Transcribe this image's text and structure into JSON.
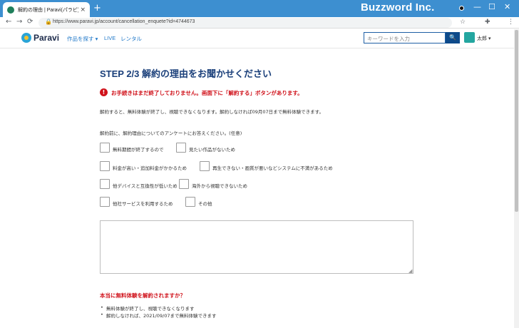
{
  "browser": {
    "tab_title": "解約の理由 | Paravi(パラビ)で見る",
    "tab_close": "×",
    "new_tab": "+",
    "brand": "Buzzword Inc.",
    "url": "https://www.paravi.jp/account/cancellation_enquete?id=4744673",
    "nav_back": "←",
    "nav_forward": "→",
    "nav_reload": "⟳",
    "lock": "🔒",
    "star": "☆",
    "ext": "✚",
    "menu": "⋮",
    "win_min": "—",
    "win_max": "☐",
    "win_close": "✕"
  },
  "site": {
    "logo_text": "Paravi",
    "nav_items": [
      "作品を探す ▾",
      "LIVE",
      "レンタル"
    ],
    "search_placeholder": "キーワードを入力",
    "search_btn": "🔍",
    "username": "太郎 ▾"
  },
  "main": {
    "step_title": "STEP 2/3 解約の理由をお聞かせください",
    "warning_icon": "!",
    "warning": "お手続きはまだ終了しておりません。画面下に「解約する」ボタンがあります。",
    "info": "解約すると、無料体験が終了し、視聴できなくなります。解約しなければ09月07日まで無料体験できます。",
    "survey_intro": "解約前に、解約理由についてのアンケートにお答えください。(任意)",
    "options": [
      "無料期間が終了するので",
      "見たい作品がないため",
      "料金が高い・追加料金がかかるため",
      "再生できない・画質が悪いなどシステムに不満があるため",
      "他デバイスと互換性が低いため",
      "海外から視聴できないため",
      "他社サービスを利用するため",
      "その他"
    ],
    "comment": "",
    "resize_handle": "◢",
    "confirm_heading": "本当に無料体験を解約されますか？",
    "bullets": [
      "無料体験が終了し、視聴できなくなります",
      "解約しなければ、2021/09/07まで無料体験できます"
    ]
  }
}
